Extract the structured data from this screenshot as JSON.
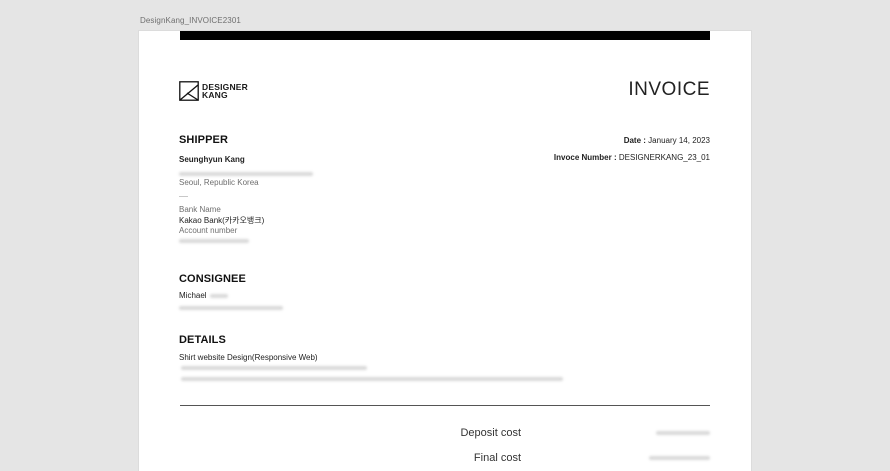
{
  "frame": {
    "label": "DesignKang_INVOICE2301"
  },
  "header": {
    "logo_line1": "DESIGNER",
    "logo_line2": "KANG",
    "title": "INVOICE"
  },
  "meta": {
    "date_key": "Date :",
    "date_value": "January 14, 2023",
    "invoice_key": "Invoce Number :",
    "invoice_value": "DESIGNERKANG_23_01"
  },
  "shipper": {
    "heading": "SHIPPER",
    "name": "Seunghyun Kang",
    "city": "Seoul, Republic Korea",
    "dash": "—",
    "bank_label": "Bank Name",
    "bank_value": "Kakao Bank(카카오뱅크)",
    "account_label": "Account number"
  },
  "consignee": {
    "heading": "CONSIGNEE",
    "name": "Michael"
  },
  "details": {
    "heading": "DETAILS",
    "item": "Shirt website Design(Responsive Web)"
  },
  "costs": {
    "deposit_label": "Deposit cost",
    "final_label": "Final cost"
  }
}
